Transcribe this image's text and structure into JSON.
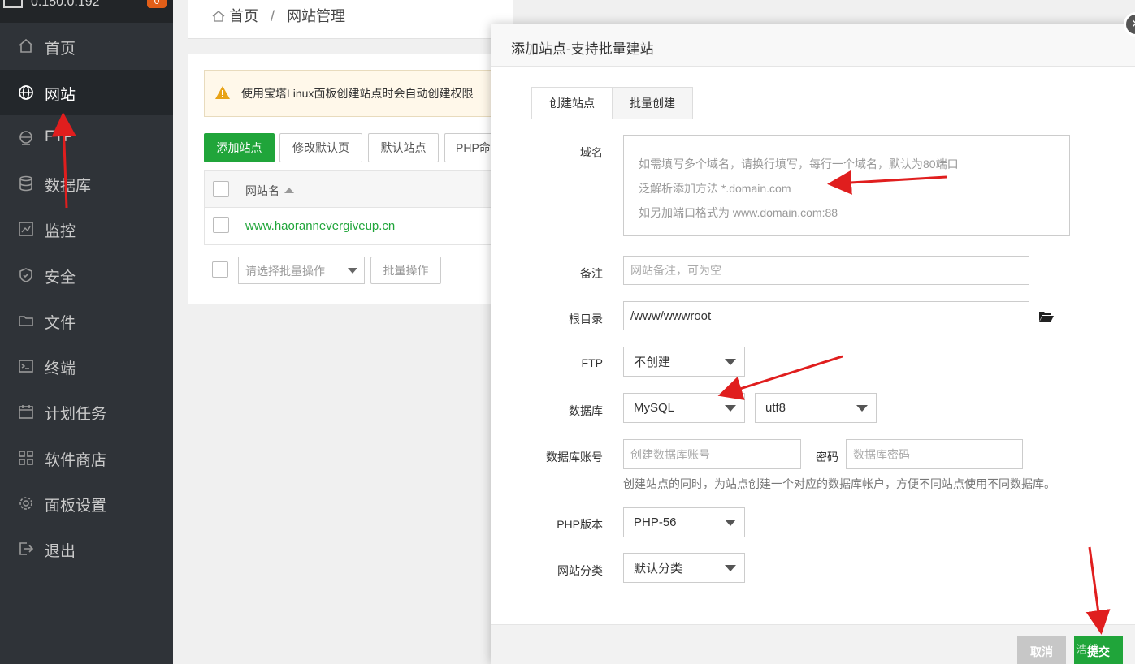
{
  "sidebar": {
    "ip": "0.150.0.192",
    "badge": "0",
    "items": [
      {
        "label": "首页",
        "icon": "home-icon"
      },
      {
        "label": "网站",
        "icon": "globe-icon",
        "active": true
      },
      {
        "label": "FTP",
        "icon": "ftp-globe-icon"
      },
      {
        "label": "数据库",
        "icon": "database-icon"
      },
      {
        "label": "监控",
        "icon": "monitor-chart-icon"
      },
      {
        "label": "安全",
        "icon": "shield-icon"
      },
      {
        "label": "文件",
        "icon": "folder-icon"
      },
      {
        "label": "终端",
        "icon": "terminal-icon"
      },
      {
        "label": "计划任务",
        "icon": "calendar-icon"
      },
      {
        "label": "软件商店",
        "icon": "grid-icon"
      },
      {
        "label": "面板设置",
        "icon": "gear-icon"
      },
      {
        "label": "退出",
        "icon": "logout-icon"
      }
    ]
  },
  "breadcrumb": {
    "home": "首页",
    "current": "网站管理"
  },
  "notice": "使用宝塔Linux面板创建站点时会自动创建权限",
  "toolbar": {
    "add_site": "添加站点",
    "edit_default": "修改默认页",
    "default_site": "默认站点",
    "php_cmd": "PHP命"
  },
  "table": {
    "col_name": "网站名",
    "rows": [
      {
        "name": "www.haorannevergiveup.cn"
      }
    ]
  },
  "batch": {
    "placeholder": "请选择批量操作",
    "button": "批量操作"
  },
  "modal": {
    "title": "添加站点-支持批量建站",
    "tabs": [
      "创建站点",
      "批量创建"
    ],
    "domain_label": "域名",
    "domain_placeholder": [
      "如需填写多个域名，请换行填写，每行一个域名，默认为80端口",
      "泛解析添加方法 *.domain.com",
      "如另加端口格式为 www.domain.com:88"
    ],
    "remark_label": "备注",
    "remark_placeholder": "网站备注，可为空",
    "root_label": "根目录",
    "root_value": "/www/wwwroot",
    "ftp_label": "FTP",
    "ftp_value": "不创建",
    "db_label": "数据库",
    "db_value": "MySQL",
    "db_charset": "utf8",
    "db_account_label": "数据库账号",
    "db_account_placeholder": "创建数据库账号",
    "password_label": "密码",
    "password_placeholder": "数据库密码",
    "db_hint": "创建站点的同时，为站点创建一个对应的数据库帐户，方便不同站点使用不同数据库。",
    "php_label": "PHP版本",
    "php_value": "PHP-56",
    "category_label": "网站分类",
    "category_value": "默认分类",
    "cancel": "取消",
    "submit": "提交",
    "close": "×"
  },
  "watermark": "浩然",
  "colors": {
    "accent": "#20a53a",
    "arrow": "#e01e1e",
    "sidebar": "#2f3338"
  }
}
